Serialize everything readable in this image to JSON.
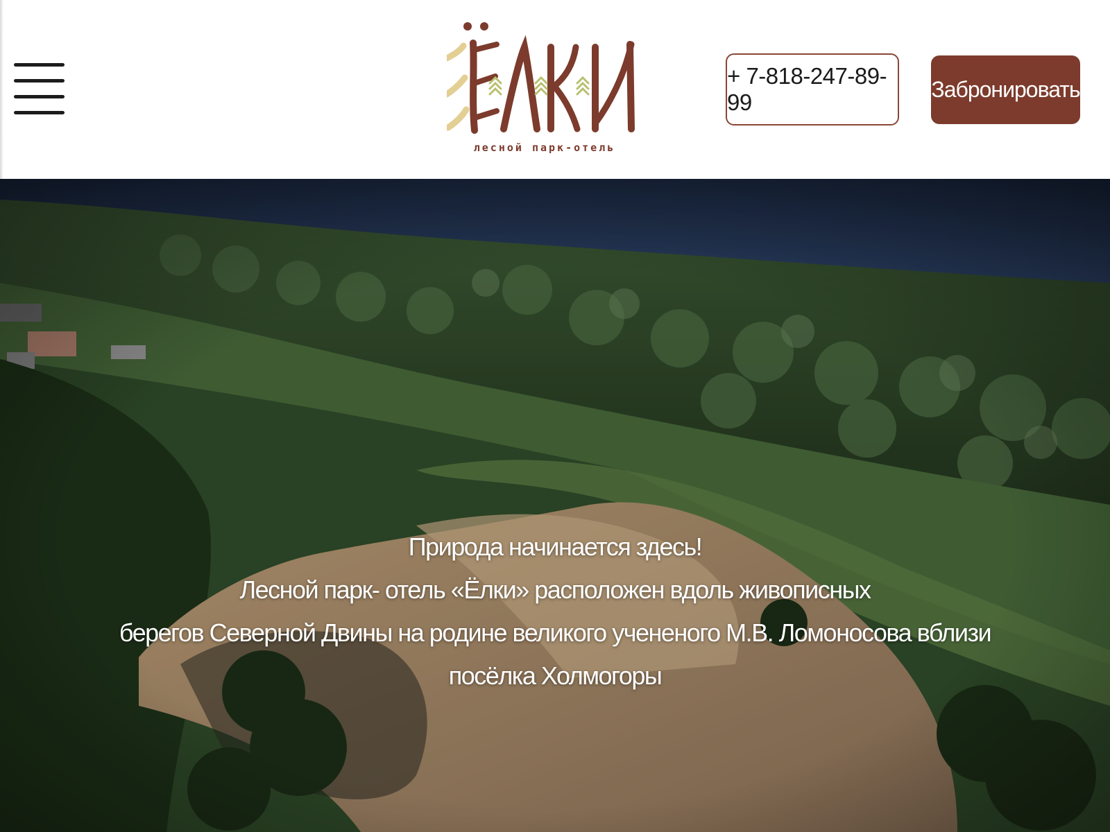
{
  "header": {
    "menu_icon": "hamburger-menu-icon",
    "logo": {
      "wordmark": "ЁЛКИ",
      "tagline": "лесной парк-отель"
    },
    "phone": "+ 7-818-247-89-99",
    "book_label": "Забронировать"
  },
  "hero": {
    "heading": "Природа начинается здесь!",
    "lines": [
      "Лесной парк- отель «Ёлки» расположен вдоль живописных",
      "берегов Северной Двины на родине великого учененого М.В. Ломоносова вблизи",
      "посёлка Холмогоры"
    ]
  },
  "colors": {
    "brand_brown": "#7c3b2c",
    "logo_gold": "#e3cf94",
    "logo_green": "#b8c070",
    "hero_text": "#ffffff"
  }
}
